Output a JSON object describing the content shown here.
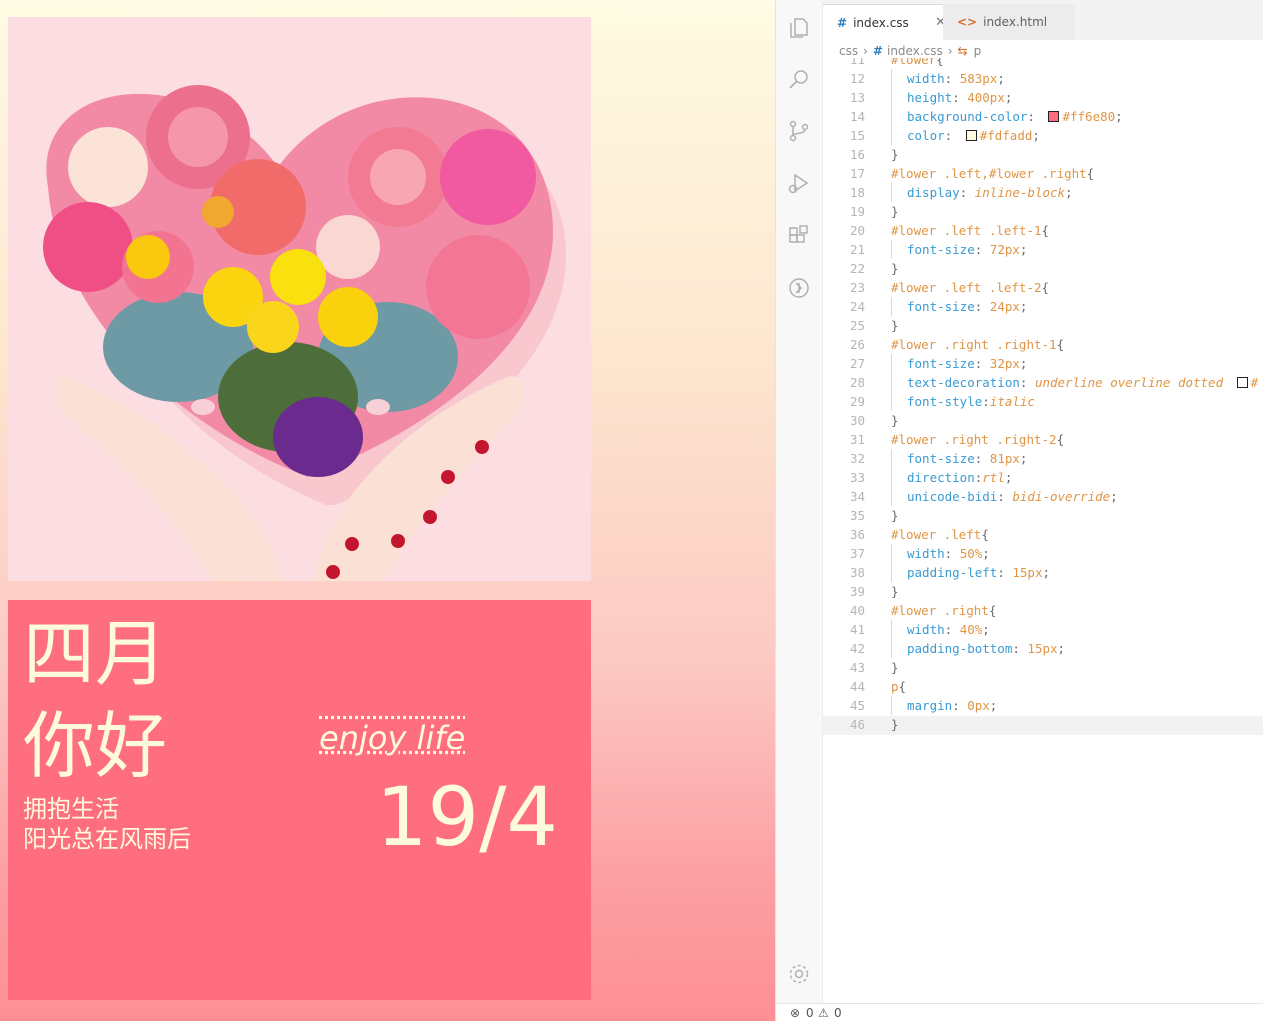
{
  "preview": {
    "colors": {
      "box_background": "#ff6e80",
      "box_text": "#fdfadd"
    },
    "image": "heart-shaped flower bouquet held by hands on pink background",
    "left": {
      "line1": "四月",
      "line2": "你好",
      "line3": "拥抱生活",
      "line4": "阳光总在风雨后"
    },
    "right": {
      "line1": "enjoy life",
      "line2": "19/4"
    }
  },
  "editor": {
    "activity_icons": [
      "files-icon",
      "search-icon",
      "source-control-icon",
      "run-debug-icon",
      "extensions-icon",
      "remote-icon"
    ],
    "settings_icon": "gear-icon",
    "tabs": [
      {
        "label": "index.css",
        "icon": "#",
        "active": true
      },
      {
        "label": "index.html",
        "icon": "<>",
        "active": false
      }
    ],
    "breadcrumbs": [
      "css",
      "index.css",
      "p"
    ],
    "code_lines": [
      {
        "n": "11",
        "t": "#lower{"
      },
      {
        "n": "12",
        "t": "width: 583px;"
      },
      {
        "n": "13",
        "t": "height: 400px;"
      },
      {
        "n": "14",
        "t": "background-color: #ff6e80;"
      },
      {
        "n": "15",
        "t": "color: #fdfadd;"
      },
      {
        "n": "16",
        "t": "}"
      },
      {
        "n": "17",
        "t": "#lower .left,#lower .right{"
      },
      {
        "n": "18",
        "t": "display: inline-block;"
      },
      {
        "n": "19",
        "t": "}"
      },
      {
        "n": "20",
        "t": "#lower .left .left-1{"
      },
      {
        "n": "21",
        "t": "font-size: 72px;"
      },
      {
        "n": "22",
        "t": "}"
      },
      {
        "n": "23",
        "t": "#lower .left .left-2{"
      },
      {
        "n": "24",
        "t": "font-size: 24px;"
      },
      {
        "n": "25",
        "t": "}"
      },
      {
        "n": "26",
        "t": "#lower .right .right-1{"
      },
      {
        "n": "27",
        "t": "font-size: 32px;"
      },
      {
        "n": "28",
        "t": "text-decoration: underline overline dotted #"
      },
      {
        "n": "29",
        "t": "font-style:italic"
      },
      {
        "n": "30",
        "t": "}"
      },
      {
        "n": "31",
        "t": "#lower .right .right-2{"
      },
      {
        "n": "32",
        "t": "font-size: 81px;"
      },
      {
        "n": "33",
        "t": "direction:rtl;"
      },
      {
        "n": "34",
        "t": "unicode-bidi: bidi-override;"
      },
      {
        "n": "35",
        "t": "}"
      },
      {
        "n": "36",
        "t": "#lower .left{"
      },
      {
        "n": "37",
        "t": "width: 50%;"
      },
      {
        "n": "38",
        "t": "padding-left: 15px;"
      },
      {
        "n": "39",
        "t": "}"
      },
      {
        "n": "40",
        "t": "#lower .right{"
      },
      {
        "n": "41",
        "t": "width: 40%;"
      },
      {
        "n": "42",
        "t": "padding-bottom: 15px;"
      },
      {
        "n": "43",
        "t": "}"
      },
      {
        "n": "44",
        "t": "p{"
      },
      {
        "n": "45",
        "t": "margin: 0px;"
      },
      {
        "n": "46",
        "t": "}"
      }
    ],
    "status": {
      "errors": "0",
      "warnings": "0"
    }
  }
}
